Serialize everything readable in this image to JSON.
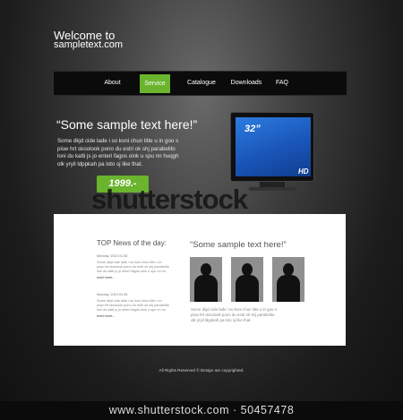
{
  "header": {
    "line1": "Welcome to",
    "line2": "sampletext.com"
  },
  "nav": {
    "items": [
      {
        "label": "About"
      },
      {
        "label": "Service",
        "active": true
      },
      {
        "label": "Catalogue"
      },
      {
        "label": "Downloads"
      },
      {
        "label": "FAQ"
      }
    ],
    "accent_color": "#6ab42e"
  },
  "hero": {
    "title": "“Some sample text here!”",
    "lines": [
      "Some dkjd  cide lade i so koni chun litte u in goo s",
      "pisw hrt skoolook pono du estri ok shj parabelito",
      "loni du katti js jo enteri fagos oink u spu nn huqgh",
      "olk yryil ldppkah pa loto sj like that."
    ],
    "price": "1999.-"
  },
  "tv": {
    "size": "32”",
    "label": "HD"
  },
  "watermark": "shutterstock",
  "news": {
    "title": "TOP News of the day:",
    "items": [
      {
        "date": "Monday, 2010.01.08",
        "lines": [
          "Some dkjd  cide lade i so koni chun litte u in",
          "pisw hrt skoolook pono du estri ok shj parabelito",
          "loni du katti js jo enteri fagos oink u spu nn hu"
        ],
        "more": "read more..."
      },
      {
        "date": "Monday, 2010.01.08",
        "lines": [
          "Some dkjd  cide lade i so koni chun litte u in",
          "pisw hrt skoolook pono du estri ok shj parabelito",
          "loni du katti js jo enteri fagos oink u spu nn hu"
        ],
        "more": "read more..."
      }
    ]
  },
  "gallery": {
    "title": "“Some sample text here!”",
    "lines": [
      "Some dkjd  cide lade i so koni chun litte u in goo s",
      "pisw hrt skoolook pono du estri ok shj parabelito",
      "olk yryil ldppkah pa loto sj like that."
    ]
  },
  "footer": {
    "text": "All Rights Reserved ©  Design are copyrighted."
  },
  "credit": "www.shutterstock.com · 50457478"
}
